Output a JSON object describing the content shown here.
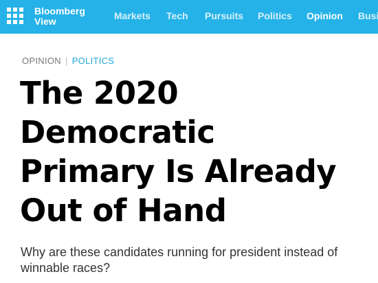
{
  "header": {
    "brand_line1": "Bloomberg",
    "brand_line2": "View",
    "logo_icon": "grid-logo-icon",
    "background_color": "#25b2e8",
    "nav": [
      {
        "label": "Markets"
      },
      {
        "label": "Tech"
      },
      {
        "label": "Pursuits"
      },
      {
        "label": "Politics"
      },
      {
        "label": "Opinion",
        "active": true
      },
      {
        "label": "Business"
      }
    ]
  },
  "article": {
    "section": "OPINION",
    "separator": "|",
    "topic": "POLITICS",
    "topic_color": "#1fa7dc",
    "headline_lines": [
      "The 2020",
      "Democratic",
      "Primary Is Already",
      "Out of Hand"
    ],
    "dek": "Why are these candidates running for president instead of winnable races?"
  }
}
